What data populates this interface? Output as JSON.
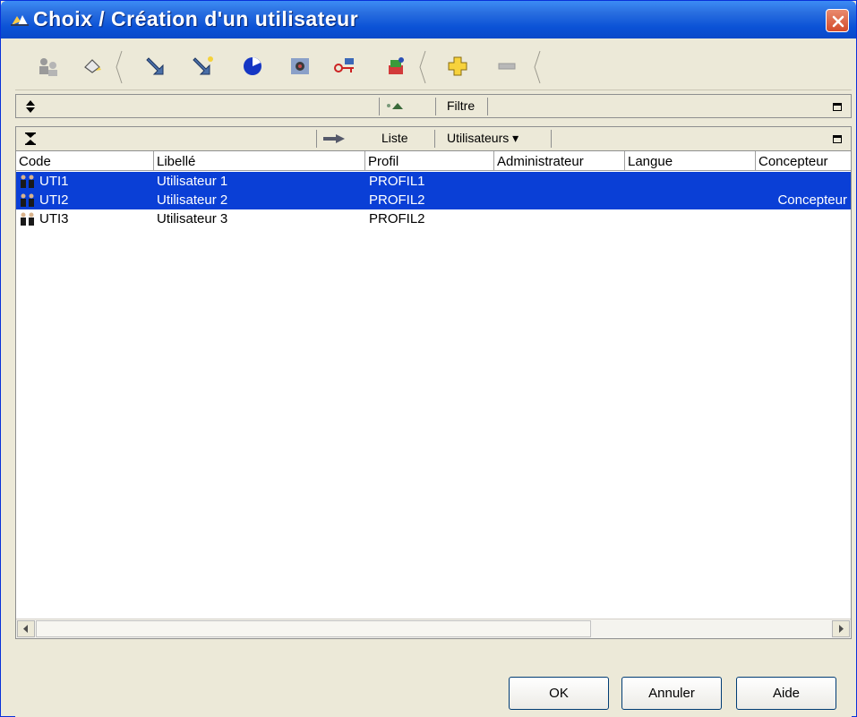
{
  "window": {
    "title": "Choix / Création d'un utilisateur"
  },
  "toolbar": {
    "icons": [
      "users-search-icon",
      "eraser-icon",
      "arrow-down-icon",
      "arrow-spark-icon",
      "pie-icon",
      "eye-icon",
      "key-icon",
      "color-tool-icon",
      "add-icon",
      "remove-icon"
    ]
  },
  "filter_panel": {
    "filter_label": "Filtre"
  },
  "list_panel": {
    "list_label": "Liste",
    "view_select": "Utilisateurs ▾"
  },
  "table": {
    "columns": [
      "Code",
      "Libellé",
      "Profil",
      "Administrateur",
      "Langue",
      "Concepteur"
    ],
    "rows": [
      {
        "code": "UTI1",
        "libelle": "Utilisateur 1",
        "profil": "PROFIL1",
        "administrateur": "",
        "langue": "",
        "concepteur": "",
        "selected": true
      },
      {
        "code": "UTI2",
        "libelle": "Utilisateur 2",
        "profil": "PROFIL2",
        "administrateur": "",
        "langue": "",
        "concepteur": "Concepteur",
        "selected": true
      },
      {
        "code": "UTI3",
        "libelle": "Utilisateur 3",
        "profil": "PROFIL2",
        "administrateur": "",
        "langue": "",
        "concepteur": "",
        "selected": false
      }
    ]
  },
  "buttons": {
    "ok": "OK",
    "cancel": "Annuler",
    "help": "Aide"
  },
  "colors": {
    "titlebar": "#0a49c9",
    "selection": "#0a3fd6",
    "face": "#ece9d8"
  }
}
